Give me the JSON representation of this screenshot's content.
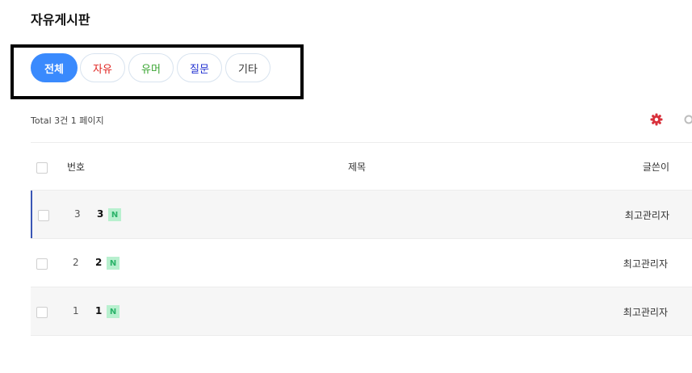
{
  "board": {
    "title": "자유게시판"
  },
  "categories": [
    {
      "label": "전체",
      "color": "#ffffff",
      "active": true
    },
    {
      "label": "자유",
      "color": "#e0231f"
    },
    {
      "label": "유머",
      "color": "#3aa532"
    },
    {
      "label": "질문",
      "color": "#1f2fd0"
    },
    {
      "label": "기타",
      "color": "#333333"
    }
  ],
  "summary": "Total 3건 1 페이지",
  "icons": {
    "settings": "gear-icon",
    "search": "search-icon"
  },
  "colors": {
    "accent": "#3a8afd",
    "gear": "#d8303b",
    "new_badge_bg": "#b8f0cf",
    "new_badge_text": "#2bb36a"
  },
  "table": {
    "headers": {
      "number": "번호",
      "subject": "제목",
      "writer": "글쓴이"
    },
    "rows": [
      {
        "number": "3",
        "subject": "3",
        "badge": "N",
        "writer": "최고관리자"
      },
      {
        "number": "2",
        "subject": "2",
        "badge": "N",
        "writer": "최고관리자"
      },
      {
        "number": "1",
        "subject": "1",
        "badge": "N",
        "writer": "최고관리자"
      }
    ]
  }
}
